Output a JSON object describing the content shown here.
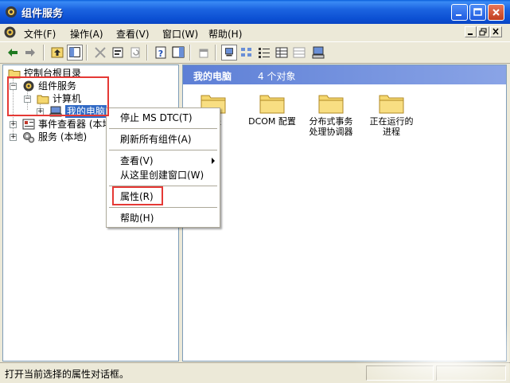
{
  "window": {
    "title": "组件服务"
  },
  "menubar": {
    "items": [
      "文件(F)",
      "操作(A)",
      "查看(V)",
      "窗口(W)",
      "帮助(H)"
    ]
  },
  "tree": {
    "items": [
      {
        "label": "控制台根目录",
        "icon": "folder-icon"
      },
      {
        "label": "组件服务",
        "icon": "component-services-icon"
      },
      {
        "label": "计算机",
        "icon": "folder-icon"
      },
      {
        "label": "我的电脑",
        "icon": "computer-icon",
        "selected": true
      },
      {
        "label": "事件查看器 (本地)",
        "icon": "event-viewer-icon"
      },
      {
        "label": "服务 (本地)",
        "icon": "services-gear-icon"
      }
    ]
  },
  "right_pane": {
    "header_title": "我的电脑",
    "header_count": "4 个对象",
    "items": [
      {
        "label": "用程",
        "icon": "folder-icon"
      },
      {
        "label": "DCOM 配置",
        "icon": "folder-icon"
      },
      {
        "label": "分布式事务处理协调器",
        "icon": "folder-icon"
      },
      {
        "label": "正在运行的进程",
        "icon": "folder-icon"
      }
    ]
  },
  "context_menu": {
    "items": [
      {
        "label": "停止 MS DTC(T)"
      },
      {
        "label": "刷新所有组件(A)"
      },
      {
        "label": "查看(V)",
        "submenu": true
      },
      {
        "label": "从这里创建窗口(W)"
      },
      {
        "label": "属性(R)",
        "highlighted": true
      },
      {
        "label": "帮助(H)"
      }
    ]
  },
  "statusbar": {
    "text": "打开当前选择的属性对话框。"
  },
  "colors": {
    "titlebar": "#0B4FD2",
    "selection": "#316AC5",
    "highlight_box": "#E53935",
    "pane_header": "#7A96DF",
    "folder": "#F5D76E"
  }
}
